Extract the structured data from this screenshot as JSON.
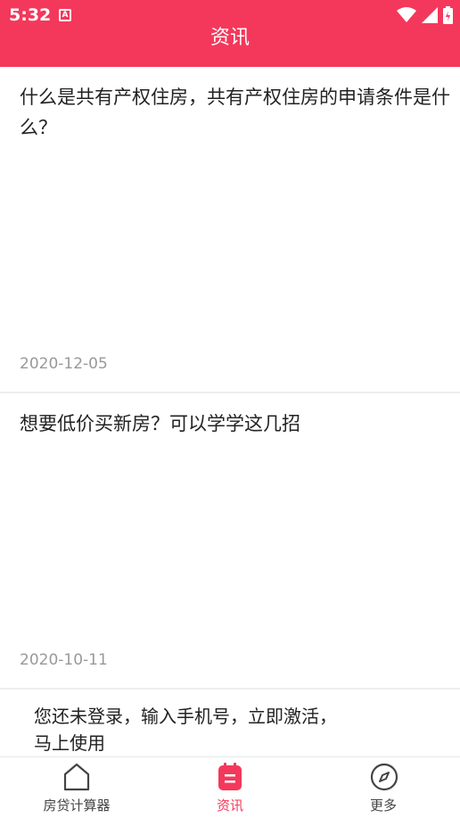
{
  "status_bar": {
    "time": "5:32",
    "notification_icon": "a-icon",
    "notification_glyph": "A",
    "icons": [
      "wifi-icon",
      "signal-icon",
      "battery-icon"
    ]
  },
  "header": {
    "title": "资讯"
  },
  "articles": [
    {
      "title": "什么是共有产权住房，共有产权住房的申请条件是什么？",
      "date": "2020-12-05"
    },
    {
      "title": "想要低价买新房？可以学学这几招",
      "date": "2020-10-11"
    }
  ],
  "login_banner": {
    "text": "您还未登录，输入手机号，立即激活，马上使用"
  },
  "tabs": [
    {
      "label": "房贷计算器",
      "icon": "home-icon",
      "active": false
    },
    {
      "label": "资讯",
      "icon": "news-icon",
      "active": true
    },
    {
      "label": "更多",
      "icon": "compass-icon",
      "active": false
    }
  ],
  "colors": {
    "accent": "#f4385b",
    "date": "#999999",
    "divider": "#eeeeee"
  }
}
